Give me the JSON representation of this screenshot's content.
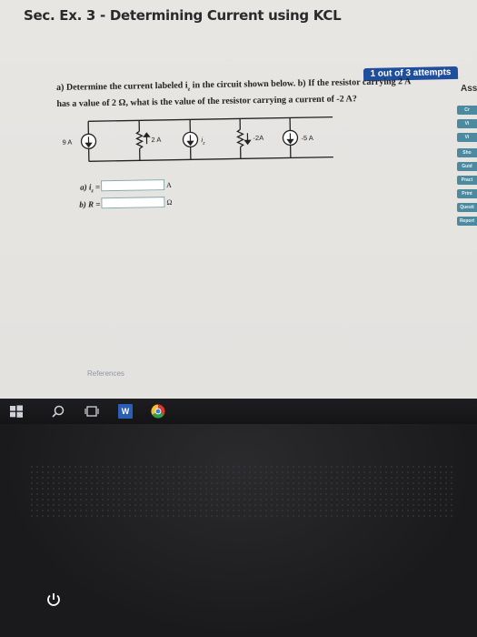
{
  "page": {
    "section_title": "Sec. Ex. 3 - Determining Current using KCL",
    "attempts": "1 out of 3 attempts",
    "question_line1": "a) Determine the current labeled i  in the circuit shown below. b) If the resistor carrying 2 A",
    "question_line2": "has a value of 2 Ω, what is the value of the resistor carrying a current of -2 A?",
    "question_subscript": "z",
    "references": "References"
  },
  "side_panel": {
    "title": "Ass",
    "buttons": [
      "Cr",
      "Vi",
      "Vi",
      "Sho",
      "Guid",
      "Pract",
      "Print",
      "Questi",
      "Report"
    ]
  },
  "circuit": {
    "source_left_label": "9 A",
    "resistor1_label": "2 A",
    "source_middle_label": "i",
    "source_middle_sub": "z",
    "resistor2_label": "-2A",
    "source_right_label": "-5 A"
  },
  "answers": {
    "a_label": "a) i  =",
    "a_sub": "z",
    "a_unit": "A",
    "a_value": "",
    "b_label": "b) R =",
    "b_unit": "Ω",
    "b_value": ""
  },
  "taskbar": {
    "icons": [
      "windows-start-icon",
      "search-icon",
      "task-view-icon",
      "word-icon",
      "chrome-icon"
    ],
    "word_letter": "W"
  },
  "colors": {
    "attempt_badge": "#1f4e9d",
    "side_button": "#4c8aa0",
    "screen_bg": "#e6e4e1",
    "bezel": "#1a1a1c"
  }
}
